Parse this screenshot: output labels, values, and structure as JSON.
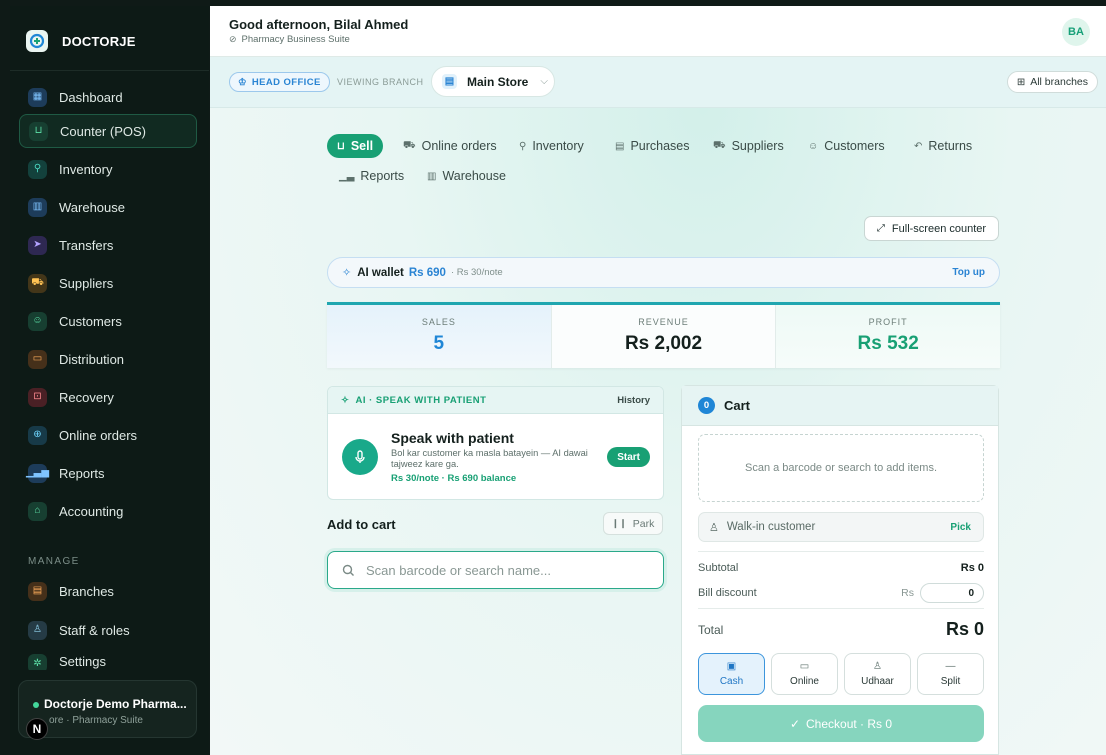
{
  "brand": {
    "name": "DOCTORJE"
  },
  "sidebar": {
    "items": [
      {
        "label": "Dashboard"
      },
      {
        "label": "Counter (POS)"
      },
      {
        "label": "Inventory"
      },
      {
        "label": "Warehouse"
      },
      {
        "label": "Transfers"
      },
      {
        "label": "Suppliers"
      },
      {
        "label": "Customers"
      },
      {
        "label": "Distribution"
      },
      {
        "label": "Recovery"
      },
      {
        "label": "Online orders"
      },
      {
        "label": "Reports"
      },
      {
        "label": "Accounting"
      }
    ],
    "manage_label": "MANAGE",
    "manage_items": [
      {
        "label": "Branches"
      },
      {
        "label": "Staff & roles"
      },
      {
        "label": "Settings"
      }
    ],
    "org": {
      "name": "Doctorje Demo Pharma...",
      "sub": "ore · Pharmacy Suite"
    },
    "n_badge": "N"
  },
  "header": {
    "greeting": "Good afternoon, Bilal Ahmed",
    "subtitle": "Pharmacy Business Suite",
    "avatar": "BA"
  },
  "branch": {
    "head_office": "HEAD OFFICE",
    "viewing_label": "VIEWING BRANCH",
    "selected": "Main Store",
    "all_branches": "All branches"
  },
  "tabs": [
    {
      "label": "Sell"
    },
    {
      "label": "Online orders"
    },
    {
      "label": "Inventory"
    },
    {
      "label": "Purchases"
    },
    {
      "label": "Suppliers"
    },
    {
      "label": "Customers"
    },
    {
      "label": "Returns"
    },
    {
      "label": "Reports"
    },
    {
      "label": "Warehouse"
    }
  ],
  "fullscreen_label": "Full-screen counter",
  "wallet": {
    "label": "AI wallet",
    "value": "Rs 690",
    "note": "· Rs 30/note",
    "topup": "Top up"
  },
  "stats": [
    {
      "label": "SALES",
      "value": "5",
      "color": "#1f86d6"
    },
    {
      "label": "REVENUE",
      "value": "Rs 2,002",
      "color": "#14201d"
    },
    {
      "label": "PROFIT",
      "value": "Rs 532",
      "color": "#18a074"
    }
  ],
  "ai_card": {
    "header": "AI · SPEAK WITH PATIENT",
    "history": "History",
    "title": "Speak with patient",
    "desc": "Bol kar customer ka masla batayein — AI dawai tajweez kare ga.",
    "balance": "Rs 30/note · Rs 690 balance",
    "start": "Start"
  },
  "add_to_cart": {
    "title": "Add to cart",
    "park": "Park",
    "search_placeholder": "Scan barcode or search name..."
  },
  "cart": {
    "count": "0",
    "title": "Cart",
    "empty_text": "Scan a barcode or search to add items.",
    "customer": "Walk-in customer",
    "pick": "Pick",
    "subtotal_label": "Subtotal",
    "subtotal_value": "Rs 0",
    "discount_label": "Bill discount",
    "discount_prefix": "Rs",
    "discount_value": "0",
    "total_label": "Total",
    "total_value": "Rs 0",
    "payments": [
      {
        "label": "Cash"
      },
      {
        "label": "Online"
      },
      {
        "label": "Udhaar"
      },
      {
        "label": "Split"
      }
    ],
    "checkout": "Checkout · Rs 0"
  },
  "colors": {
    "accent_green": "#18a074",
    "accent_blue": "#1f86d6",
    "sidebar_bg": "#0d1a16"
  }
}
